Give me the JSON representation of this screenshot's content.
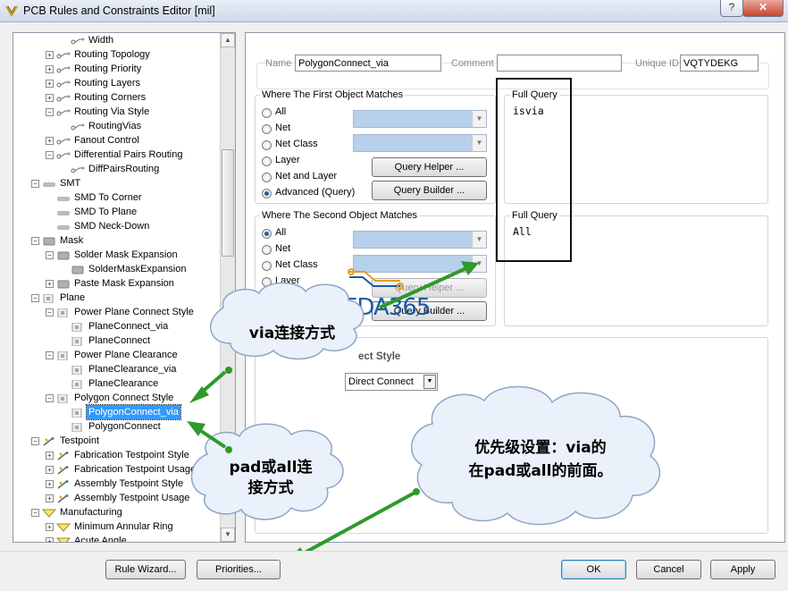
{
  "window": {
    "title": "PCB Rules and Constraints Editor [mil]",
    "help_glyph": "?",
    "close_glyph": "✕"
  },
  "tree": {
    "items": [
      {
        "label": "Width",
        "level": 3,
        "expander": "",
        "icon": "rule"
      },
      {
        "label": "Routing Topology",
        "level": 2,
        "expander": "+",
        "icon": "rule"
      },
      {
        "label": "Routing Priority",
        "level": 2,
        "expander": "+",
        "icon": "rule"
      },
      {
        "label": "Routing Layers",
        "level": 2,
        "expander": "+",
        "icon": "rule"
      },
      {
        "label": "Routing Corners",
        "level": 2,
        "expander": "+",
        "icon": "rule"
      },
      {
        "label": "Routing Via Style",
        "level": 2,
        "expander": "−",
        "icon": "rule"
      },
      {
        "label": "RoutingVias",
        "level": 3,
        "expander": "",
        "icon": "rule"
      },
      {
        "label": "Fanout Control",
        "level": 2,
        "expander": "+",
        "icon": "rule"
      },
      {
        "label": "Differential Pairs Routing",
        "level": 2,
        "expander": "−",
        "icon": "rule"
      },
      {
        "label": "DiffPairsRouting",
        "level": 3,
        "expander": "",
        "icon": "rule"
      },
      {
        "label": "SMT",
        "level": 1,
        "expander": "−",
        "icon": "cat"
      },
      {
        "label": "SMD To Corner",
        "level": 2,
        "expander": "",
        "icon": "cat"
      },
      {
        "label": "SMD To Plane",
        "level": 2,
        "expander": "",
        "icon": "cat"
      },
      {
        "label": "SMD Neck-Down",
        "level": 2,
        "expander": "",
        "icon": "cat"
      },
      {
        "label": "Mask",
        "level": 1,
        "expander": "−",
        "icon": "mask"
      },
      {
        "label": "Solder Mask Expansion",
        "level": 2,
        "expander": "−",
        "icon": "mask"
      },
      {
        "label": "SolderMaskExpansion",
        "level": 3,
        "expander": "",
        "icon": "mask"
      },
      {
        "label": "Paste Mask Expansion",
        "level": 2,
        "expander": "+",
        "icon": "mask"
      },
      {
        "label": "Plane",
        "level": 1,
        "expander": "−",
        "icon": "plane"
      },
      {
        "label": "Power Plane Connect Style",
        "level": 2,
        "expander": "−",
        "icon": "plane"
      },
      {
        "label": "PlaneConnect_via",
        "level": 3,
        "expander": "",
        "icon": "plane"
      },
      {
        "label": "PlaneConnect",
        "level": 3,
        "expander": "",
        "icon": "plane"
      },
      {
        "label": "Power Plane Clearance",
        "level": 2,
        "expander": "−",
        "icon": "plane"
      },
      {
        "label": "PlaneClearance_via",
        "level": 3,
        "expander": "",
        "icon": "plane"
      },
      {
        "label": "PlaneClearance",
        "level": 3,
        "expander": "",
        "icon": "plane"
      },
      {
        "label": "Polygon Connect Style",
        "level": 2,
        "expander": "−",
        "icon": "plane"
      },
      {
        "label": "PolygonConnect_via",
        "level": 3,
        "expander": "",
        "icon": "plane",
        "selected": true
      },
      {
        "label": "PolygonConnect",
        "level": 3,
        "expander": "",
        "icon": "plane"
      },
      {
        "label": "Testpoint",
        "level": 1,
        "expander": "−",
        "icon": "test"
      },
      {
        "label": "Fabrication Testpoint Style",
        "level": 2,
        "expander": "+",
        "icon": "test"
      },
      {
        "label": "Fabrication Testpoint Usage",
        "level": 2,
        "expander": "+",
        "icon": "test"
      },
      {
        "label": "Assembly Testpoint Style",
        "level": 2,
        "expander": "+",
        "icon": "test"
      },
      {
        "label": "Assembly Testpoint Usage",
        "level": 2,
        "expander": "+",
        "icon": "test"
      },
      {
        "label": "Manufacturing",
        "level": 1,
        "expander": "−",
        "icon": "mfg"
      },
      {
        "label": "Minimum Annular Ring",
        "level": 2,
        "expander": "+",
        "icon": "mfg"
      },
      {
        "label": "Acute Angle",
        "level": 2,
        "expander": "+",
        "icon": "mfg"
      }
    ]
  },
  "rule": {
    "name_label": "Name",
    "name_value": "PolygonConnect_via",
    "comment_label": "Comment",
    "comment_value": "",
    "uid_label": "Unique ID",
    "uid_value": "VQTYDEKG"
  },
  "first": {
    "title": "Where The First Object Matches",
    "options": [
      "All",
      "Net",
      "Net Class",
      "Layer",
      "Net and Layer",
      "Advanced (Query)"
    ],
    "selected": "Advanced (Query)",
    "query_helper": "Query Helper ...",
    "query_builder": "Query Builder ...",
    "full_query_title": "Full Query",
    "full_query": "isvia"
  },
  "second": {
    "title": "Where The Second Object Matches",
    "options": [
      "All",
      "Net",
      "Net Class",
      "Layer"
    ],
    "selected": "All",
    "query_helper": "Query Helper ...",
    "query_builder": "Query Builder ...",
    "full_query_title": "Full Query",
    "full_query": "All"
  },
  "constraints": {
    "title_partial": "ect Style",
    "connect_style": "Direct Connect"
  },
  "watermark": "EDA365",
  "callouts": {
    "via": "via连接方式",
    "pad": [
      "pad或all连",
      "接方式"
    ],
    "priority": [
      "优先级设置：via的",
      "在pad或all的前面。"
    ]
  },
  "buttons": {
    "rule_wizard": "Rule Wizard...",
    "priorities": "Priorities...",
    "ok": "OK",
    "cancel": "Cancel",
    "apply": "Apply"
  },
  "colors": {
    "accent_arrow": "#2e9a2a",
    "selection": "#3399ff",
    "cloud_fill": "#eaf1fb",
    "cloud_stroke": "#8ea6c4",
    "watermark": "#1a5aa8"
  }
}
